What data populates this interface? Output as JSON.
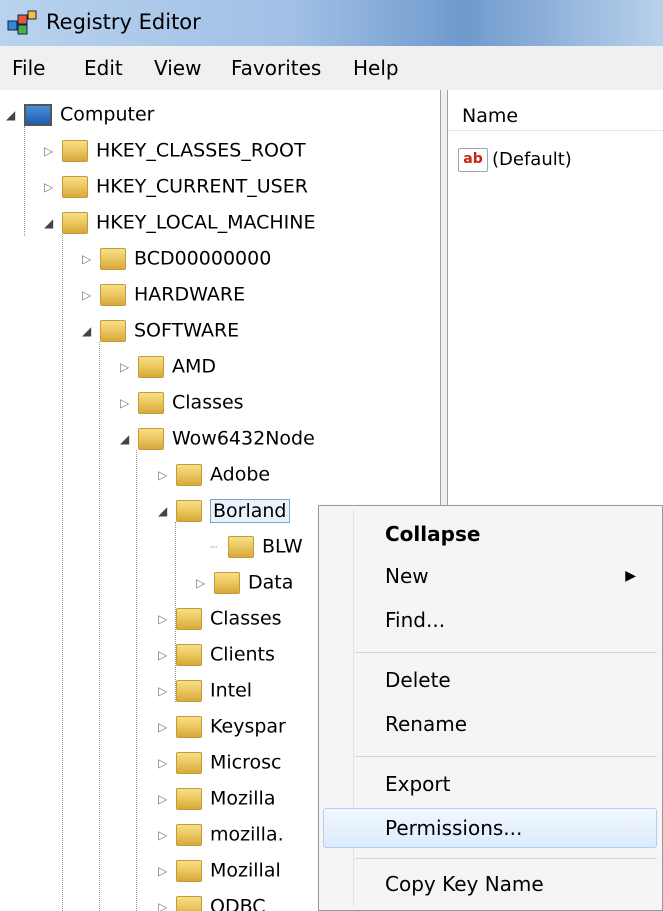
{
  "window": {
    "title": "Registry Editor"
  },
  "menu": [
    "File",
    "Edit",
    "View",
    "Favorites",
    "Help"
  ],
  "right_pane": {
    "column_name": "Name",
    "values": [
      {
        "icon": "string-value-icon",
        "badge": "ab",
        "name": "(Default)"
      }
    ]
  },
  "tree": {
    "root": "Computer",
    "hives": [
      "HKEY_CLASSES_ROOT",
      "HKEY_CURRENT_USER",
      "HKEY_LOCAL_MACHINE"
    ],
    "hklm_children": [
      "BCD00000000",
      "HARDWARE",
      "SOFTWARE"
    ],
    "software_children": [
      "AMD",
      "Classes",
      "Wow6432Node"
    ],
    "wow_children": [
      "Adobe",
      "Borland",
      "Classes",
      "Clients",
      "Intel",
      "Keyspar",
      "Microsc",
      "Mozilla",
      "mozilla.",
      "Mozillal",
      "ODBC"
    ],
    "borland_children": [
      "BLW",
      "Data"
    ]
  },
  "context_menu": {
    "collapse": "Collapse",
    "new": "New",
    "find": "Find...",
    "delete": "Delete",
    "rename": "Rename",
    "export": "Export",
    "permissions": "Permissions...",
    "copy_key_name": "Copy Key Name"
  }
}
